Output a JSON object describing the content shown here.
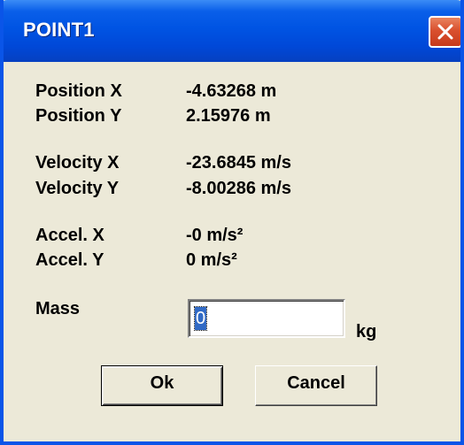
{
  "window": {
    "title": "POINT1"
  },
  "fields": {
    "position_x": {
      "label": "Position X",
      "value": "-4.63268 m"
    },
    "position_y": {
      "label": "Position Y",
      "value": "2.15976 m"
    },
    "velocity_x": {
      "label": "Velocity X",
      "value": "-23.6845 m/s"
    },
    "velocity_y": {
      "label": "Velocity Y",
      "value": "-8.00286 m/s"
    },
    "accel_x": {
      "label": "Accel. X",
      "value": "-0 m/s²"
    },
    "accel_y": {
      "label": "Accel. Y",
      "value": "0 m/s²"
    }
  },
  "mass": {
    "label": "Mass",
    "value": "0",
    "unit": "kg"
  },
  "buttons": {
    "ok": "Ok",
    "cancel": "Cancel"
  },
  "colors": {
    "titlebar": "#0054e3",
    "dialog_background": "#ece9d8",
    "close_button": "#d9502e",
    "selection": "#316ac5"
  },
  "icons": {
    "close": "close-icon"
  }
}
